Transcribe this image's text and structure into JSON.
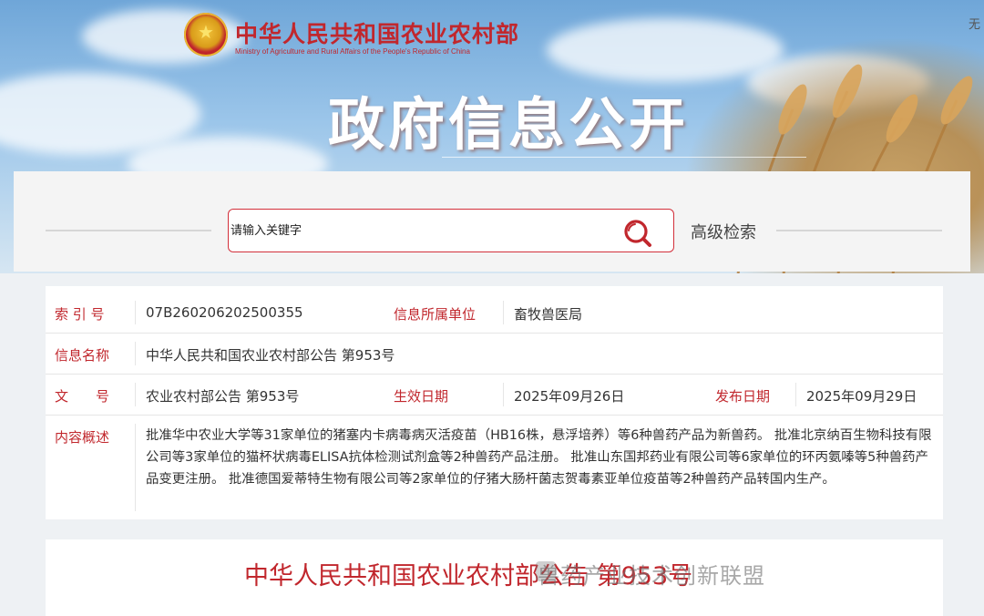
{
  "header": {
    "ministry_cn": "中华人民共和国农业农村部",
    "ministry_en": "Ministry of Agriculture and Rural Affairs of the People's Republic of China",
    "hero_title": "政府信息公开",
    "corner_text": "无"
  },
  "search": {
    "placeholder": "请输入关键字",
    "advanced_label": "高级检索",
    "icon": "search-icon"
  },
  "info": {
    "index_label": "索 引 号",
    "index_value": "07B260206202500355",
    "dept_label": "信息所属单位",
    "dept_value": "畜牧兽医局",
    "name_label": "信息名称",
    "name_value": "中华人民共和国农业农村部公告 第953号",
    "doc_label": "文　　号",
    "doc_value": "农业农村部公告 第953号",
    "effective_label": "生效日期",
    "effective_value": "2025年09月26日",
    "publish_label": "发布日期",
    "publish_value": "2025年09月29日",
    "summary_label": "内容概述",
    "summary_value": "批准华中农业大学等31家单位的猪塞内卡病毒病灭活疫苗（HB16株，悬浮培养）等6种兽药产品为新兽药。 批准北京纳百生物科技有限公司等3家单位的猫杯状病毒ELISA抗体检测试剂盒等2种兽药产品注册。 批准山东国邦药业有限公司等6家单位的环丙氨嗪等5种兽药产品变更注册。 批准德国爱蒂特生物有限公司等2家单位的仔猪大肠杆菌志贺毒素亚单位疫苗等2种兽药产品转国内生产。"
  },
  "document": {
    "title": "中华人民共和国农业农村部公告 第953号"
  },
  "watermark": {
    "text": "兽药产业技术创新联盟"
  },
  "colors": {
    "accent_red": "#c1272d",
    "search_border": "#d22f3a"
  }
}
